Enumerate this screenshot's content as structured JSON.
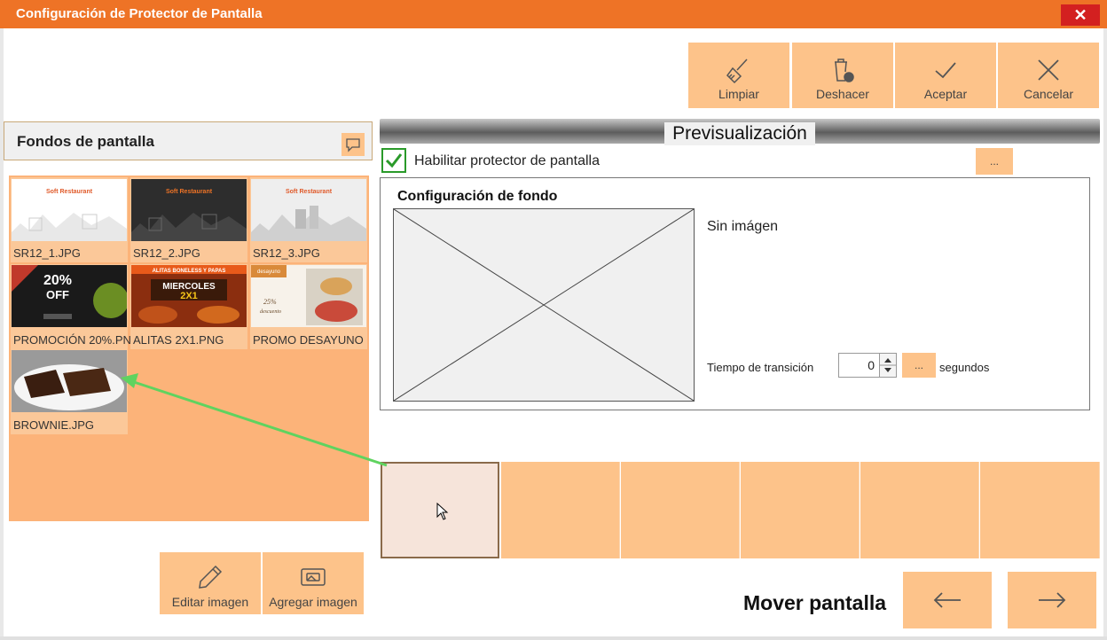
{
  "window": {
    "title": "Configuración de Protector de Pantalla",
    "close_label": "✕"
  },
  "toolbar": {
    "items": [
      {
        "label": "Limpiar",
        "icon": "broom-icon"
      },
      {
        "label": "Deshacer",
        "icon": "undo-trash-icon"
      },
      {
        "label": "Aceptar",
        "icon": "check-icon"
      },
      {
        "label": "Cancelar",
        "icon": "close-icon"
      }
    ]
  },
  "left_panel": {
    "title": "Fondos de pantalla",
    "images": [
      {
        "label": "SR12_1.JPG",
        "brand": "Soft Restaurant",
        "theme": "light"
      },
      {
        "label": "SR12_2.JPG",
        "brand": "Soft Restaurant",
        "theme": "dark"
      },
      {
        "label": "SR12_3.JPG",
        "brand": "Soft Restaurant",
        "theme": "gray"
      },
      {
        "label": "PROMOCIÓN 20%.PN",
        "promo_text": "20% OFF"
      },
      {
        "label": "ALITAS 2X1.PNG",
        "promo_text": "MIERCOLES 2X1",
        "banner": "ALITAS BONELESS Y PAPAS"
      },
      {
        "label": "PROMO DESAYUNO",
        "promo_text": "desayuno SALUDABLE",
        "discount": "25%",
        "sub": "descuento"
      },
      {
        "label": "BROWNIE.JPG"
      }
    ],
    "edit_label": "Editar imagen",
    "add_label": "Agregar imagen"
  },
  "preview": {
    "title": "Previsualización",
    "enable_label": "Habilitar protector de pantalla",
    "enabled": true,
    "dots": "...",
    "config_title": "Configuración de fondo",
    "no_image": "Sin imágen",
    "transition_label": "Tiempo de transición",
    "transition_value": "0",
    "transition_unit": "segundos"
  },
  "footer": {
    "move_label": "Mover pantalla"
  },
  "colors": {
    "accent": "#ee7326",
    "button": "#fdc38a",
    "gallery": "#fcb379",
    "arrow": "#5fd35f"
  }
}
